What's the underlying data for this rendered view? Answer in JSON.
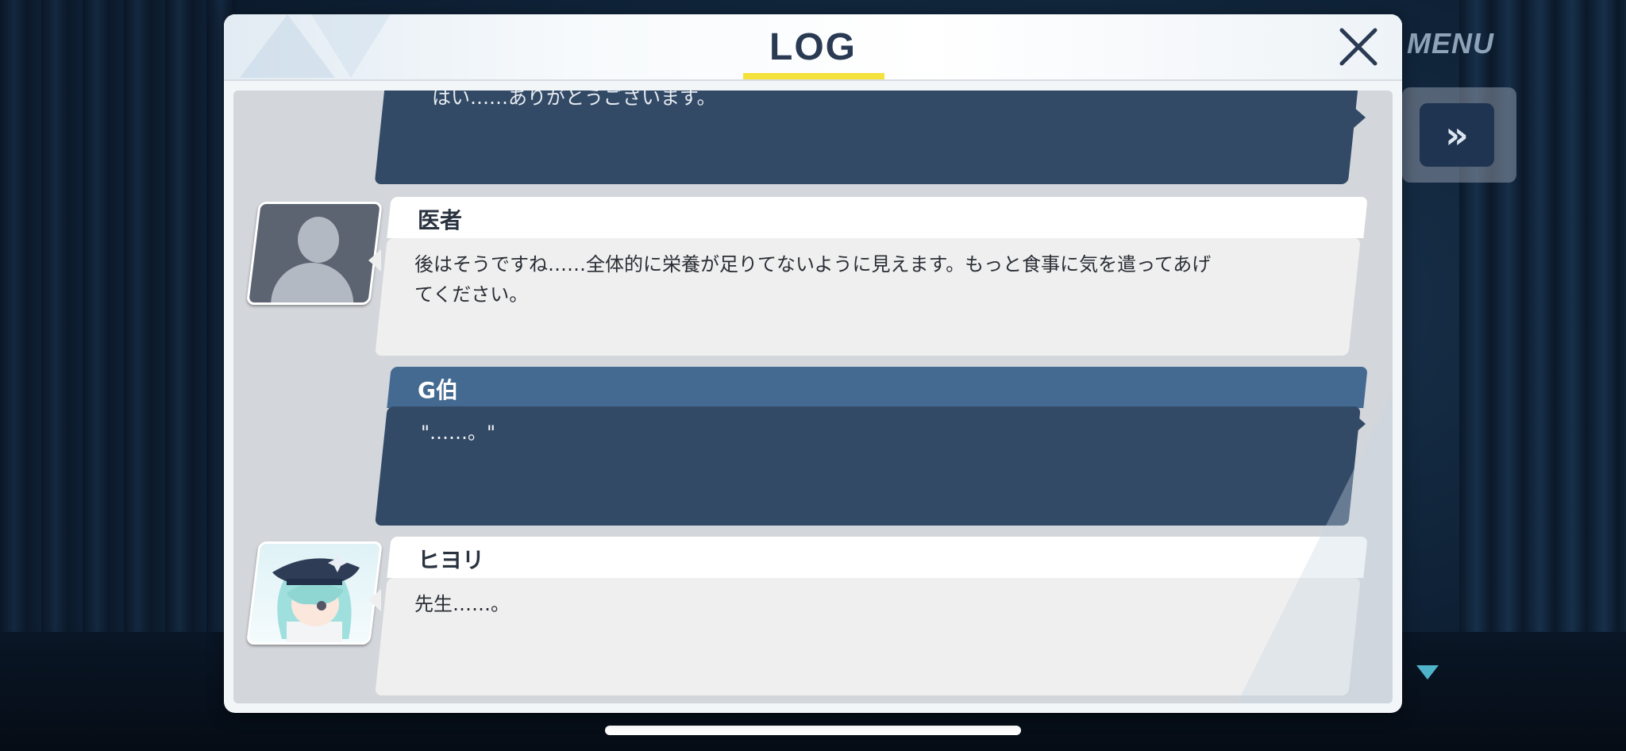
{
  "scene": {
    "menu_label": "MENU",
    "fast_forward_icon": "double-chevron-right-icon",
    "fast_forward_glyph": "»",
    "colors": {
      "accent": "#f4e13c",
      "player_bubble": "#334a66",
      "npc_bubble": "#efefef",
      "player_name_bar": "#456a92"
    }
  },
  "dialog": {
    "title": "LOG",
    "close_icon": "close-icon"
  },
  "log": [
    {
      "speaker": "",
      "is_player": true,
      "text": "はい……ありがとうございます。"
    },
    {
      "speaker": "医者",
      "is_player": false,
      "avatar": "blank-silhouette-avatar",
      "text": "後はそうですね……全体的に栄養が足りてないように見えます。もっと食事に気を遣ってあげ\nてください。"
    },
    {
      "speaker": "G伯",
      "is_player": true,
      "text": "\"……。\""
    },
    {
      "speaker": "ヒヨリ",
      "is_player": false,
      "avatar": "hiyori-avatar",
      "text": "先生……。"
    }
  ]
}
